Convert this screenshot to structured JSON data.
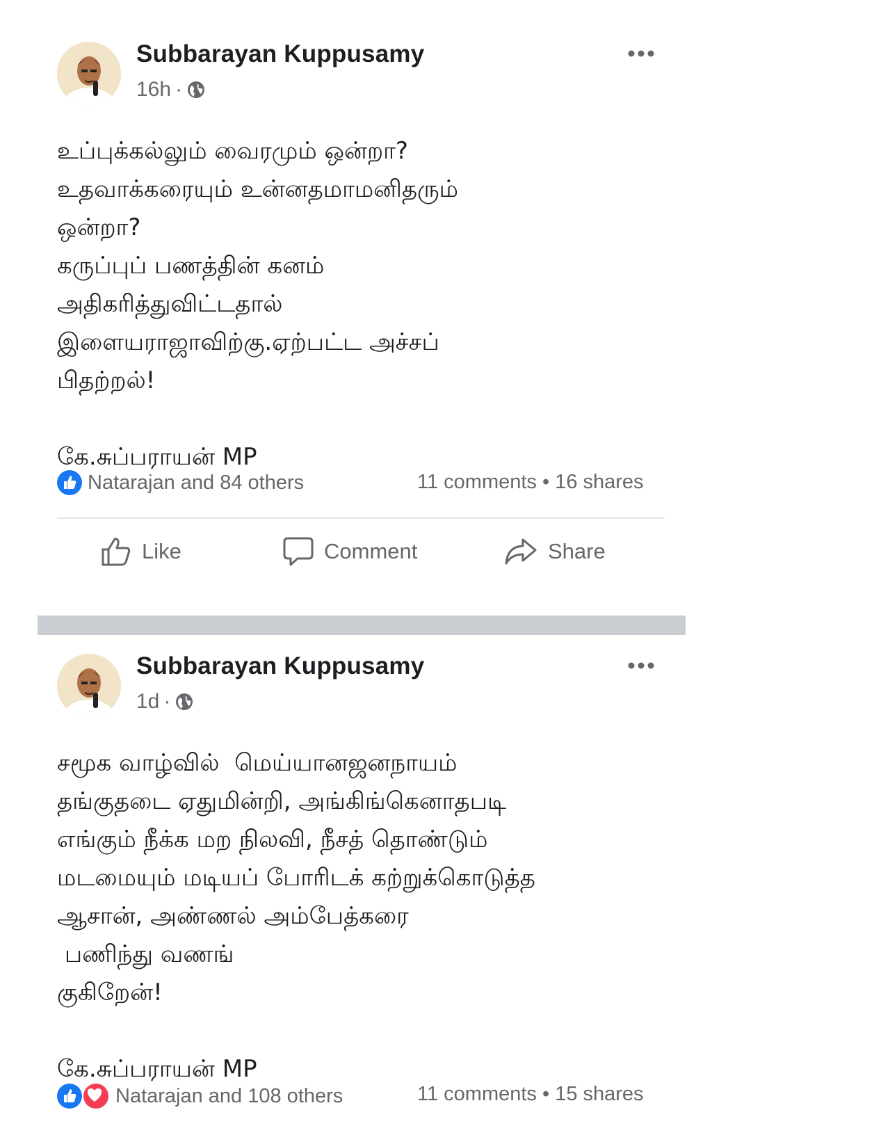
{
  "posts": [
    {
      "author": "Subbarayan Kuppusamy",
      "time": "16h",
      "meta_separator": "·",
      "body": "உப்புக்கல்லும் வைரமும் ஒன்றா?\nஉதவாக்கரையும் உன்னதமாமனிதரும்\nஒன்றா?\nகருப்புப் பணத்தின் கனம்\nஅதிகரித்துவிட்டதால்\nஇளையராஜாவிற்கு.ஏற்பட்ட அச்சப்\nபிதற்றல்!\n\nகே.சுப்பராயன் MP",
      "reactions_text": "Natarajan and 84 others",
      "reaction_types": [
        "like-icon"
      ],
      "counts_text": "11 comments • 16 shares",
      "actions": {
        "like": "Like",
        "comment": "Comment",
        "share": "Share"
      }
    },
    {
      "author": "Subbarayan Kuppusamy",
      "time": "1d",
      "meta_separator": "·",
      "body": "சமூக வாழ்வில்  மெய்யானஜனநாயம்\nதங்குதடை ஏதுமின்றி, அங்கிங்கெனாதபடி\nஎங்கும் நீக்க மற நிலவி, நீசத் தொண்டும்\nமடமையும் மடியப் போரிடக் கற்றுக்கொடுத்த\nஆசான், அண்ணல் அம்பேத்கரை\n பணிந்து வணங்\nகுகிறேன்!\n\nகே.சுப்பராயன் MP",
      "reactions_text": "Natarajan and 108 others",
      "reaction_types": [
        "like-icon",
        "love-icon"
      ],
      "counts_text": "11 comments • 15 shares"
    }
  ],
  "colors": {
    "text": "#1c1e21",
    "secondary": "#65676b",
    "like_blue": "#1877f2",
    "love_red": "#f33e58",
    "separator": "#c9ccd1"
  }
}
